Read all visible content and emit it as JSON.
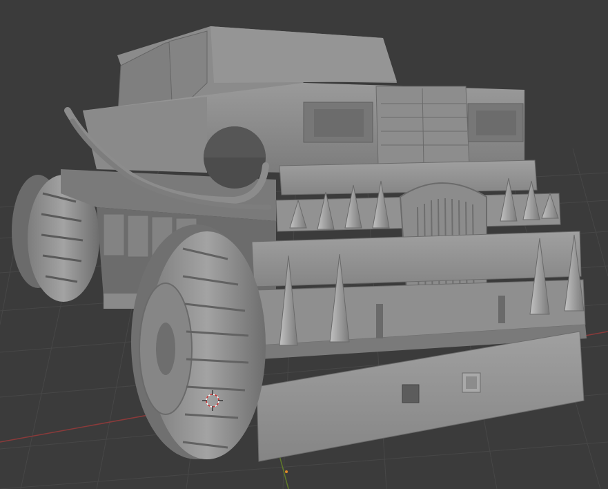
{
  "viewport": {
    "background_color": "#3b3b3b",
    "grid_color": "#474747",
    "x_axis_color": "#8a3a3a",
    "y_axis_color": "#5f7a2a",
    "model_base_color": "#8e8e8e",
    "model_shadow_color": "#5c5c5c",
    "model_highlight_color": "#b4b4b4"
  },
  "icons": {
    "cursor": "3d-cursor-icon",
    "origin": "object-origin-icon"
  }
}
